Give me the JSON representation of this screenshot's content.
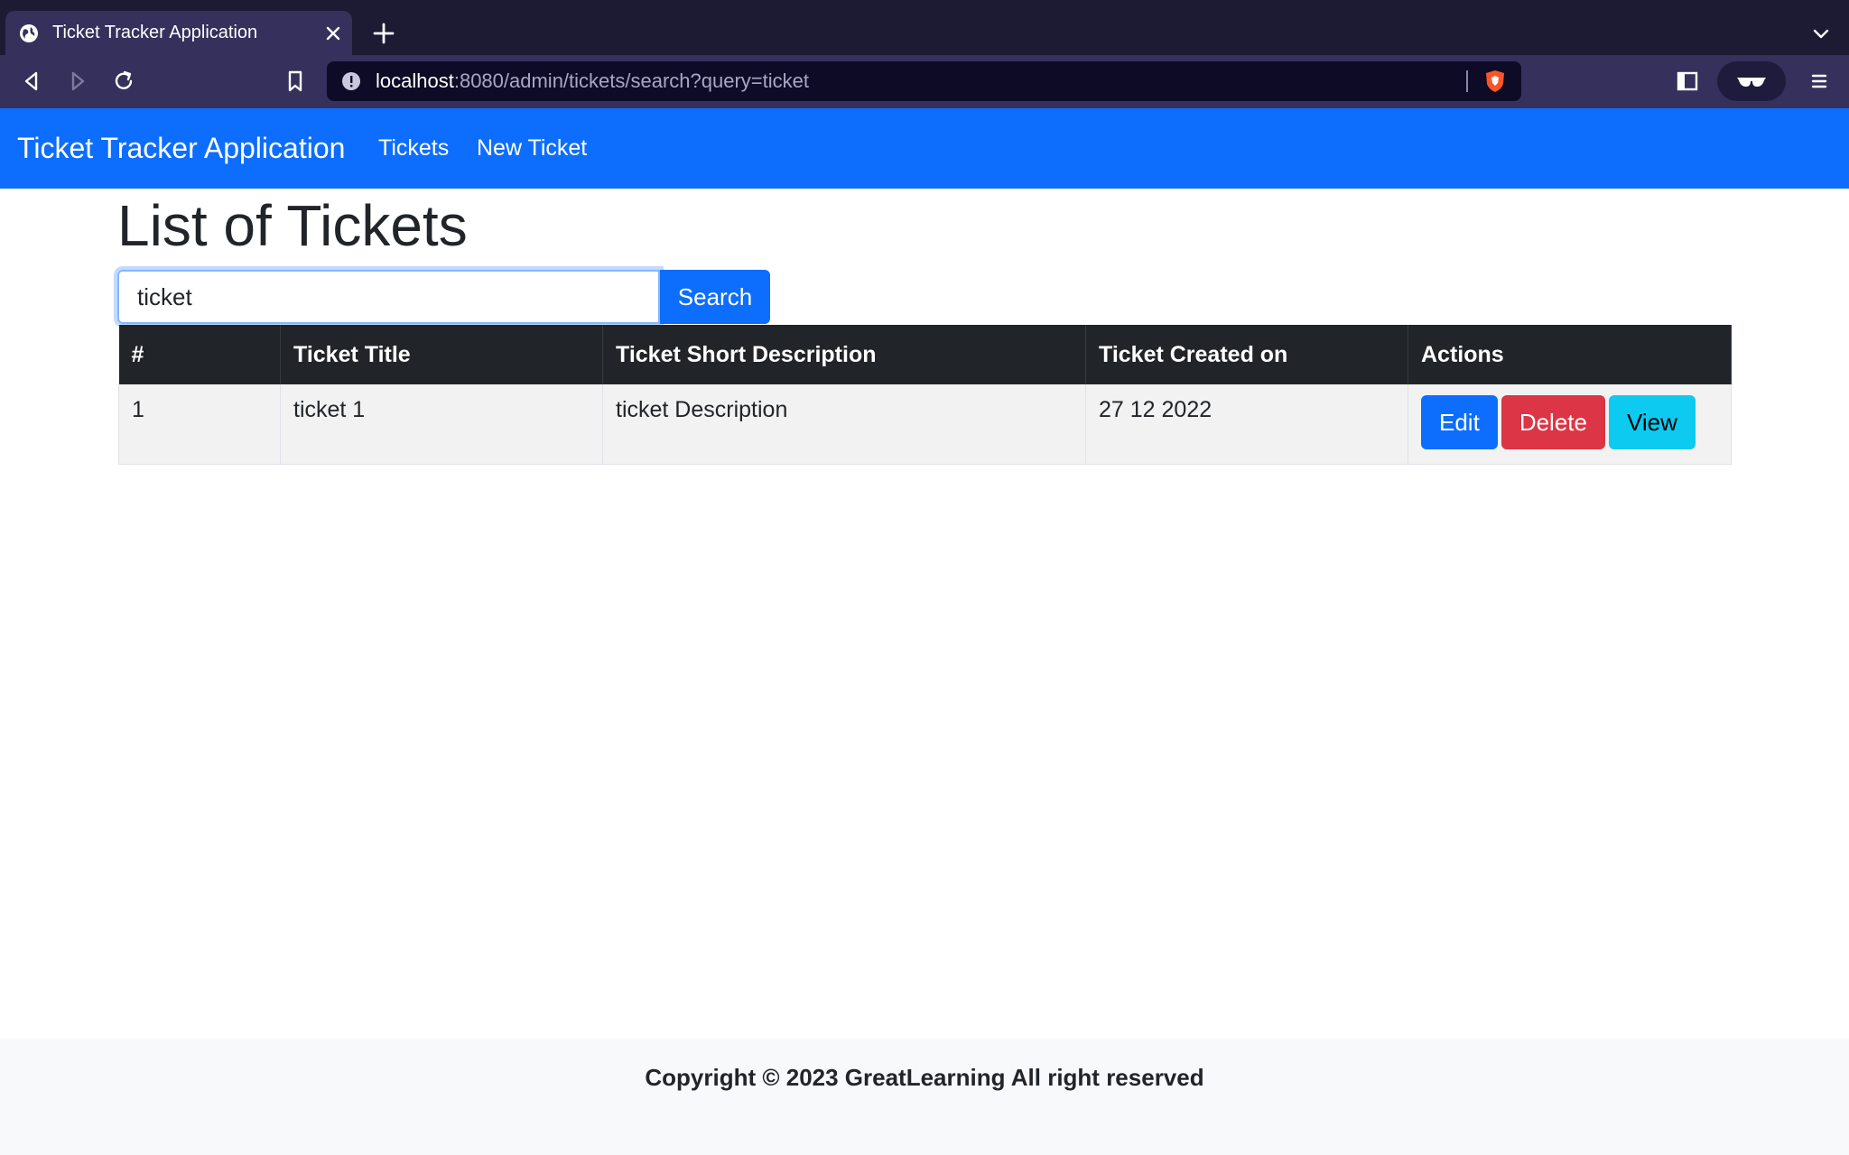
{
  "browser": {
    "tab_title": "Ticket Tracker Application",
    "url_host": "localhost",
    "url_rest": ":8080/admin/tickets/search?query=ticket"
  },
  "navbar": {
    "brand": "Ticket Tracker Application",
    "links": [
      "Tickets",
      "New Ticket"
    ]
  },
  "page": {
    "title": "List of Tickets",
    "search": {
      "value": "ticket",
      "button_label": "Search"
    }
  },
  "table": {
    "headers": [
      "#",
      "Ticket Title",
      "Ticket Short Description",
      "Ticket Created on",
      "Actions"
    ],
    "rows": [
      {
        "num": "1",
        "title": "ticket 1",
        "description": "ticket Description",
        "created": "27 12 2022"
      }
    ],
    "actions": {
      "edit": "Edit",
      "delete": "Delete",
      "view": "View"
    }
  },
  "footer": {
    "text": "Copyright © 2023 GreatLearning All right reserved"
  },
  "colors": {
    "primary": "#0d6efd",
    "danger": "#dc3545",
    "info": "#0dcaf0",
    "table_header": "#212529",
    "browser_chrome": "#35305c"
  }
}
